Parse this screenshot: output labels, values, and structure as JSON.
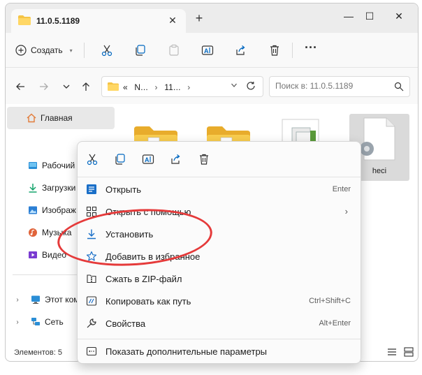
{
  "window": {
    "tab_title": "11.0.5.1189",
    "tab_close_glyph": "✕",
    "new_tab_glyph": "+",
    "minimize_glyph": "—",
    "maximize_glyph": "☐",
    "close_glyph": "✕"
  },
  "toolbar": {
    "create_label": "Создать",
    "icons": [
      "cut-icon",
      "copy-icon",
      "paste-icon",
      "rename-icon",
      "share-icon",
      "delete-icon"
    ],
    "more_glyph": "···"
  },
  "address": {
    "crumb_prefix": "«",
    "crumbs": [
      "N...",
      "11..."
    ],
    "search_placeholder": "Поиск в: 11.0.5.1189"
  },
  "sidebar": {
    "home": "Главная",
    "items": [
      {
        "label": "Рабочий",
        "icon": "desktop-icon"
      },
      {
        "label": "Загрузки",
        "icon": "downloads-icon"
      },
      {
        "label": "Изображ",
        "icon": "pictures-icon"
      },
      {
        "label": "Музыка",
        "icon": "music-icon"
      },
      {
        "label": "Видео",
        "icon": "videos-icon"
      }
    ],
    "tree": [
      {
        "label": "Этот комп",
        "icon": "this-pc-icon"
      },
      {
        "label": "Сеть",
        "icon": "network-icon"
      }
    ]
  },
  "content": {
    "files": [
      {
        "label": "",
        "icon": "folder-icon"
      },
      {
        "label": "",
        "icon": "folder-icon"
      },
      {
        "label": "",
        "icon": "document-icon"
      },
      {
        "label": "heci",
        "icon": "inf-settings-icon"
      }
    ]
  },
  "status": {
    "count": "Элементов: 5"
  },
  "context_menu": {
    "quick_actions": [
      "cut-icon",
      "copy-icon",
      "rename-icon",
      "share-icon",
      "delete-icon"
    ],
    "items": [
      {
        "label": "Открыть",
        "shortcut": "Enter",
        "icon": "open-icon"
      },
      {
        "label": "Открыть с помощью",
        "shortcut": "",
        "icon": "open-with-icon",
        "submenu": true
      },
      {
        "label": "Установить",
        "shortcut": "",
        "icon": "install-icon"
      },
      {
        "label": "Добавить в избранное",
        "shortcut": "",
        "icon": "star-icon"
      },
      {
        "label": "Сжать в ZIP-файл",
        "shortcut": "",
        "icon": "zip-icon"
      },
      {
        "label": "Копировать как путь",
        "shortcut": "Ctrl+Shift+C",
        "icon": "copy-path-icon"
      },
      {
        "label": "Свойства",
        "shortcut": "Alt+Enter",
        "icon": "properties-icon"
      },
      {
        "label": "Показать дополнительные параметры",
        "shortcut": "",
        "icon": "more-options-icon"
      }
    ]
  },
  "colors": {
    "accent": "#0067c0",
    "folder": "#f5c445",
    "highlight": "#e53a3a"
  }
}
